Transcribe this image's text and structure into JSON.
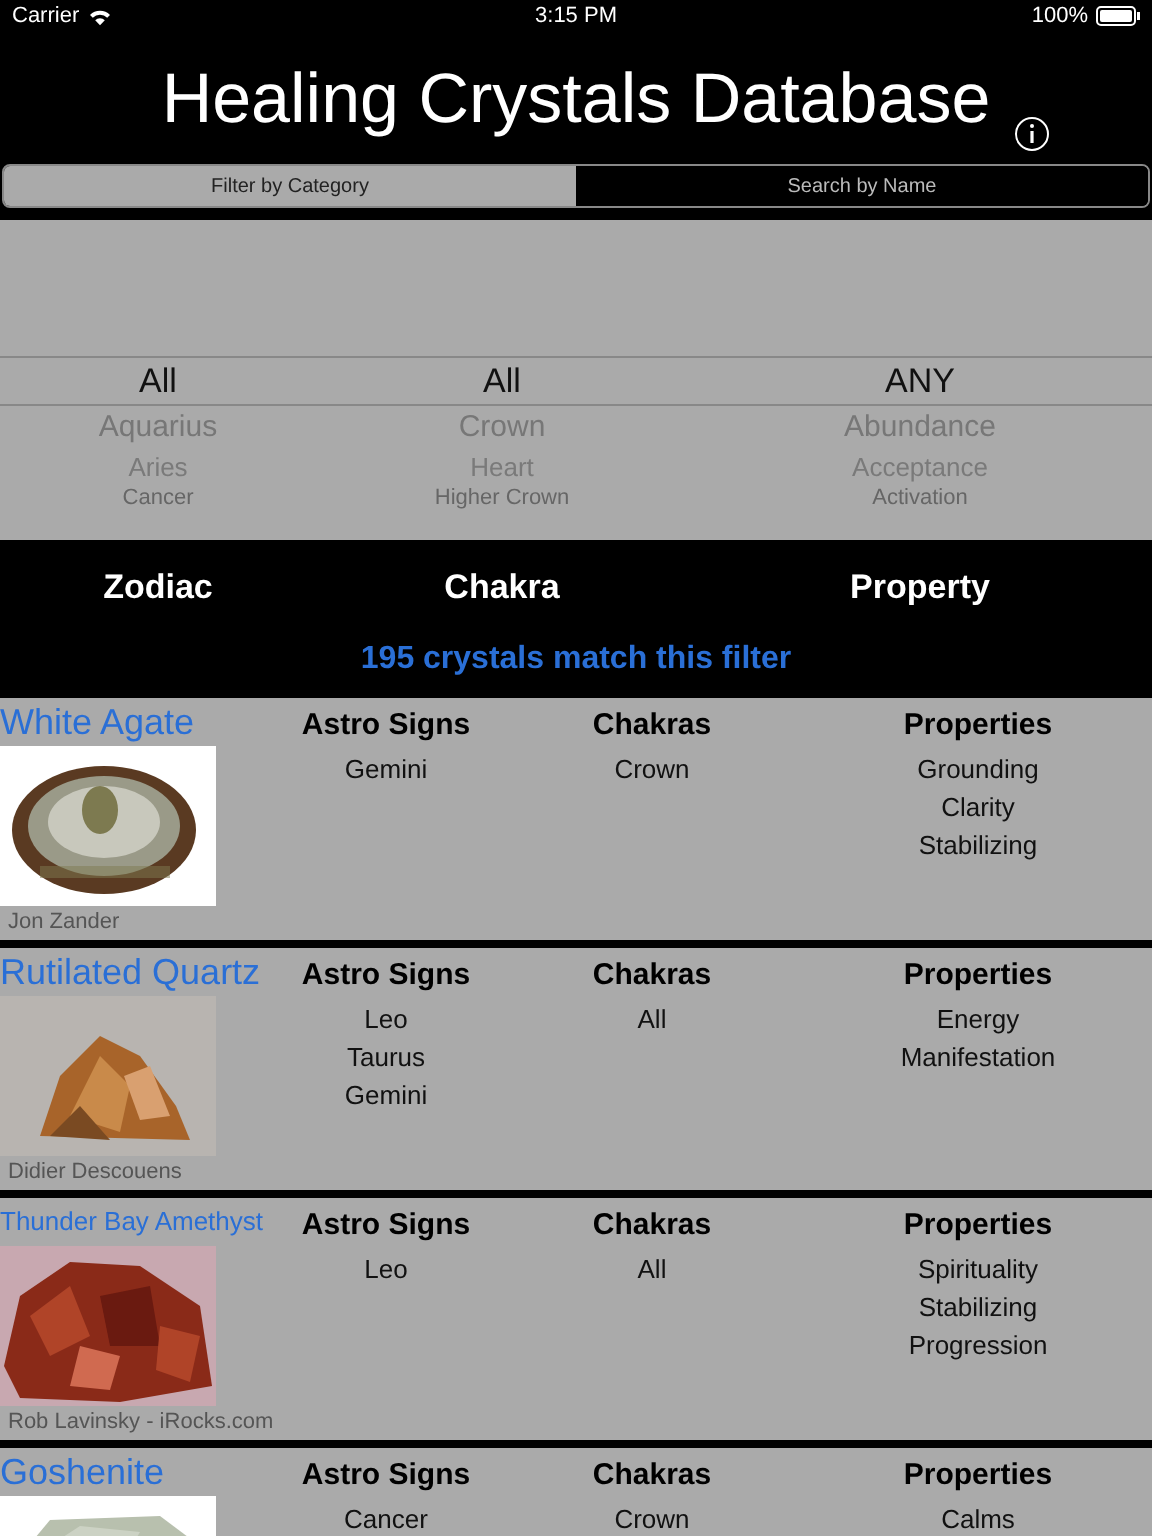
{
  "status_bar": {
    "carrier": "Carrier",
    "time": "3:15 PM",
    "battery": "100%"
  },
  "title": "Healing Crystals Database",
  "segments": [
    {
      "label": "Filter by Category",
      "selected": true
    },
    {
      "label": "Search by Name",
      "selected": false
    }
  ],
  "picker": [
    {
      "selected_value": "All",
      "items": [
        "Aquarius",
        "Aries",
        "Cancer"
      ]
    },
    {
      "selected_value": "All",
      "items": [
        "Crown",
        "Heart",
        "Higher Crown"
      ]
    },
    {
      "selected_value": "ANY",
      "items": [
        "Abundance",
        "Acceptance",
        "Activation"
      ]
    }
  ],
  "filter_labels": [
    "Zodiac",
    "Chakra",
    "Property"
  ],
  "match_count": "195 crystals match this filter",
  "crystals": [
    {
      "name": "White Agate",
      "credit": "Jon Zander",
      "image": {
        "kind": "picture"
      },
      "groups": [
        {
          "heading": "Astro Signs",
          "values": [
            "Gemini"
          ]
        },
        {
          "heading": "Chakras",
          "values": [
            "Crown"
          ]
        },
        {
          "heading": "Properties",
          "values": [
            "Grounding",
            "Clarity",
            "Stabilizing"
          ]
        }
      ]
    },
    {
      "name": "Rutilated Quartz",
      "credit": "Didier Descouens",
      "image": {
        "kind": "picture"
      },
      "groups": [
        {
          "heading": "Astro Signs",
          "values": [
            "Leo",
            "Taurus",
            "Gemini"
          ]
        },
        {
          "heading": "Chakras",
          "values": [
            "All"
          ]
        },
        {
          "heading": "Properties",
          "values": [
            "Energy",
            "Manifestation"
          ]
        }
      ]
    },
    {
      "name": "Thunder Bay Amethyst",
      "credit": "Rob Lavinsky - iRocks.com",
      "image": {
        "kind": "picture"
      },
      "groups": [
        {
          "heading": "Astro Signs",
          "values": [
            "Leo"
          ]
        },
        {
          "heading": "Chakras",
          "values": [
            "All"
          ]
        },
        {
          "heading": "Properties",
          "values": [
            "Spirituality",
            "Stabilizing",
            "Progression"
          ]
        }
      ]
    },
    {
      "name": "Goshenite",
      "image": {
        "kind": "picture"
      },
      "groups": [
        {
          "heading": "Astro Signs",
          "values": [
            "Cancer"
          ]
        },
        {
          "heading": "Chakras",
          "values": [
            "Crown"
          ]
        },
        {
          "heading": "Properties",
          "values": [
            "Calms"
          ]
        }
      ]
    }
  ]
}
